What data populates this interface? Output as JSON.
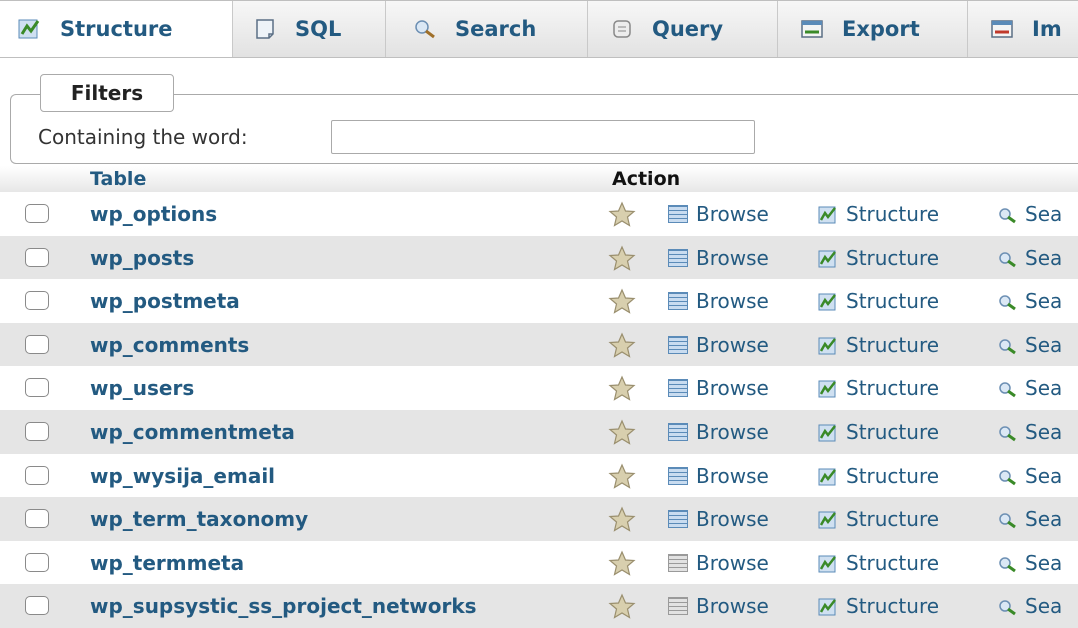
{
  "tabs": [
    {
      "label": "Structure",
      "icon": "structure-icon",
      "active": true
    },
    {
      "label": "SQL",
      "icon": "sql-icon",
      "active": false
    },
    {
      "label": "Search",
      "icon": "search-icon",
      "active": false
    },
    {
      "label": "Query",
      "icon": "query-icon",
      "active": false
    },
    {
      "label": "Export",
      "icon": "export-icon",
      "active": false
    },
    {
      "label": "Im",
      "icon": "import-icon",
      "active": false
    }
  ],
  "filters": {
    "legend": "Filters",
    "label": "Containing the word:",
    "value": ""
  },
  "table": {
    "header_table": "Table",
    "header_action": "Action",
    "actions": {
      "browse": "Browse",
      "structure": "Structure",
      "search": "Sea"
    },
    "rows": [
      {
        "name": "wp_options",
        "browse_empty": false
      },
      {
        "name": "wp_posts",
        "browse_empty": false
      },
      {
        "name": "wp_postmeta",
        "browse_empty": false
      },
      {
        "name": "wp_comments",
        "browse_empty": false
      },
      {
        "name": "wp_users",
        "browse_empty": false
      },
      {
        "name": "wp_commentmeta",
        "browse_empty": false
      },
      {
        "name": "wp_wysija_email",
        "browse_empty": false
      },
      {
        "name": "wp_term_taxonomy",
        "browse_empty": false
      },
      {
        "name": "wp_termmeta",
        "browse_empty": true
      },
      {
        "name": "wp_supsystic_ss_project_networks",
        "browse_empty": true
      }
    ]
  },
  "colors": {
    "link": "#235a81",
    "row_alt": "#e5e5e5",
    "tab_bg": "#eaeaea"
  }
}
